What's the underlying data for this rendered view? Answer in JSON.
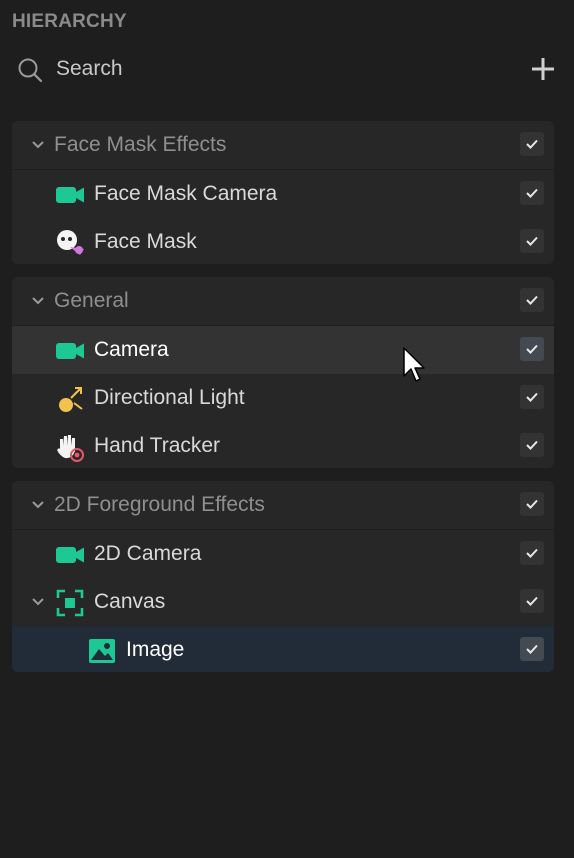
{
  "panel": {
    "title": "HIERARCHY"
  },
  "search": {
    "label": "Search"
  },
  "groups": [
    {
      "name": "Face Mask Effects",
      "items": [
        {
          "label": "Face Mask Camera",
          "icon": "camera-icon"
        },
        {
          "label": "Face Mask",
          "icon": "face-mask-icon"
        }
      ]
    },
    {
      "name": "General",
      "items": [
        {
          "label": "Camera",
          "icon": "camera-icon",
          "state": "hovered"
        },
        {
          "label": "Directional Light",
          "icon": "directional-light-icon"
        },
        {
          "label": "Hand Tracker",
          "icon": "hand-tracker-icon"
        }
      ]
    },
    {
      "name": "2D Foreground Effects",
      "items": [
        {
          "label": "2D Camera",
          "icon": "camera-icon"
        },
        {
          "label": "Canvas",
          "icon": "canvas-icon",
          "expanded": true
        },
        {
          "label": "Image",
          "icon": "image-icon",
          "state": "selected"
        }
      ]
    }
  ],
  "colors": {
    "accent": "#1ec894",
    "background": "#1e1e1e",
    "group_bg": "#272727",
    "selected_bg": "#222c38",
    "hover_bg": "#333333"
  }
}
